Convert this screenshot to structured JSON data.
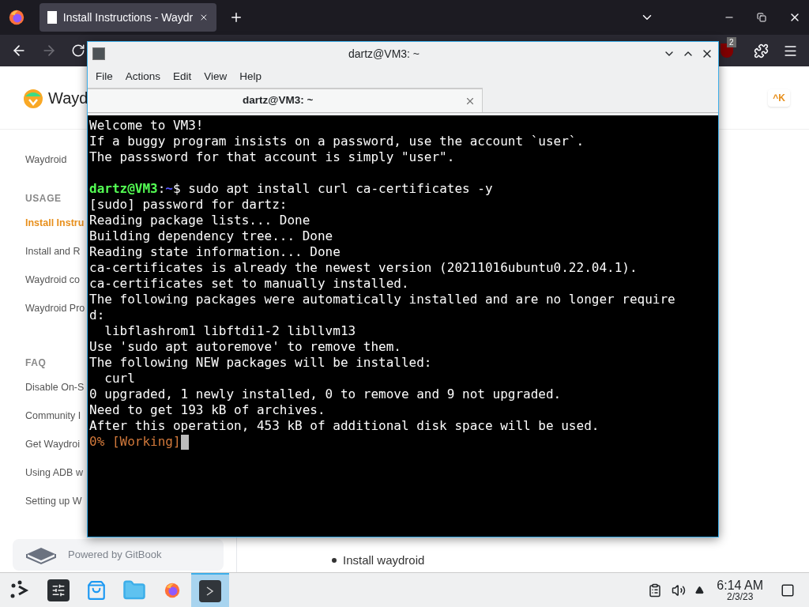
{
  "browser": {
    "tabs": [
      {
        "title": "Install Instructions - Waydr",
        "selected": true
      }
    ],
    "notification_count": "2",
    "forward_disabled": true
  },
  "page": {
    "brand": "Wayd",
    "search_key": "^K",
    "sidebar": [
      {
        "kind": "item",
        "label": "Waydroid",
        "selected": false
      },
      {
        "kind": "header",
        "label": "USAGE"
      },
      {
        "kind": "item",
        "label": "Install Instru",
        "selected": true
      },
      {
        "kind": "item",
        "label": "Install and R",
        "selected": false
      },
      {
        "kind": "item",
        "label": "Waydroid co",
        "selected": false
      },
      {
        "kind": "item",
        "label": "Waydroid Pro",
        "selected": false
      },
      {
        "kind": "header",
        "label": "FAQ"
      },
      {
        "kind": "item",
        "label": "Disable On-S",
        "selected": false
      },
      {
        "kind": "item",
        "label": "Community I",
        "selected": false
      },
      {
        "kind": "item",
        "label": "Get Waydroi",
        "selected": false
      },
      {
        "kind": "item",
        "label": "Using ADB w",
        "selected": false
      },
      {
        "kind": "item",
        "label": "Setting up W",
        "selected": false
      }
    ],
    "powered_by": "Powered by GitBook",
    "bullet": "Install waydroid"
  },
  "terminal": {
    "title": "dartz@VM3: ~",
    "menu": [
      "File",
      "Actions",
      "Edit",
      "View",
      "Help"
    ],
    "tab": "dartz@VM3: ~",
    "lines": [
      {
        "kind": "text",
        "text": "Welcome to VM3!"
      },
      {
        "kind": "text",
        "text": "If a buggy program insists on a password, use the account `user`."
      },
      {
        "kind": "text",
        "text": "The passsword for that account is simply \"user\"."
      },
      {
        "kind": "blank"
      },
      {
        "kind": "prompt",
        "user": "dartz@VM3",
        "separator": ":",
        "path": "~",
        "text": "$ sudo apt install curl ca-certificates -y"
      },
      {
        "kind": "text",
        "text": "[sudo] password for dartz:"
      },
      {
        "kind": "text",
        "text": "Reading package lists... Done"
      },
      {
        "kind": "text",
        "text": "Building dependency tree... Done"
      },
      {
        "kind": "text",
        "text": "Reading state information... Done"
      },
      {
        "kind": "text",
        "text": "ca-certificates is already the newest version (20211016ubuntu0.22.04.1)."
      },
      {
        "kind": "text",
        "text": "ca-certificates set to manually installed."
      },
      {
        "kind": "text",
        "text": "The following packages were automatically installed and are no longer require"
      },
      {
        "kind": "text",
        "text": "d:"
      },
      {
        "kind": "text",
        "text": "  libflashrom1 libftdi1-2 libllvm13"
      },
      {
        "kind": "text",
        "text": "Use 'sudo apt autoremove' to remove them."
      },
      {
        "kind": "text",
        "text": "The following NEW packages will be installed:"
      },
      {
        "kind": "text",
        "text": "  curl"
      },
      {
        "kind": "text",
        "text": "0 upgraded, 1 newly installed, 0 to remove and 9 not upgraded."
      },
      {
        "kind": "text",
        "text": "Need to get 193 kB of archives."
      },
      {
        "kind": "text",
        "text": "After this operation, 453 kB of additional disk space will be used."
      },
      {
        "kind": "progress",
        "text": "0% [Working]"
      }
    ]
  },
  "taskbar": {
    "apps": [
      {
        "kind": "settings",
        "selected": false
      },
      {
        "kind": "store",
        "selected": false
      },
      {
        "kind": "folder",
        "selected": false
      },
      {
        "kind": "firefox",
        "selected": false
      },
      {
        "kind": "terminal",
        "selected": true
      }
    ],
    "time": "6:14 AM",
    "date": "2/3/23"
  }
}
